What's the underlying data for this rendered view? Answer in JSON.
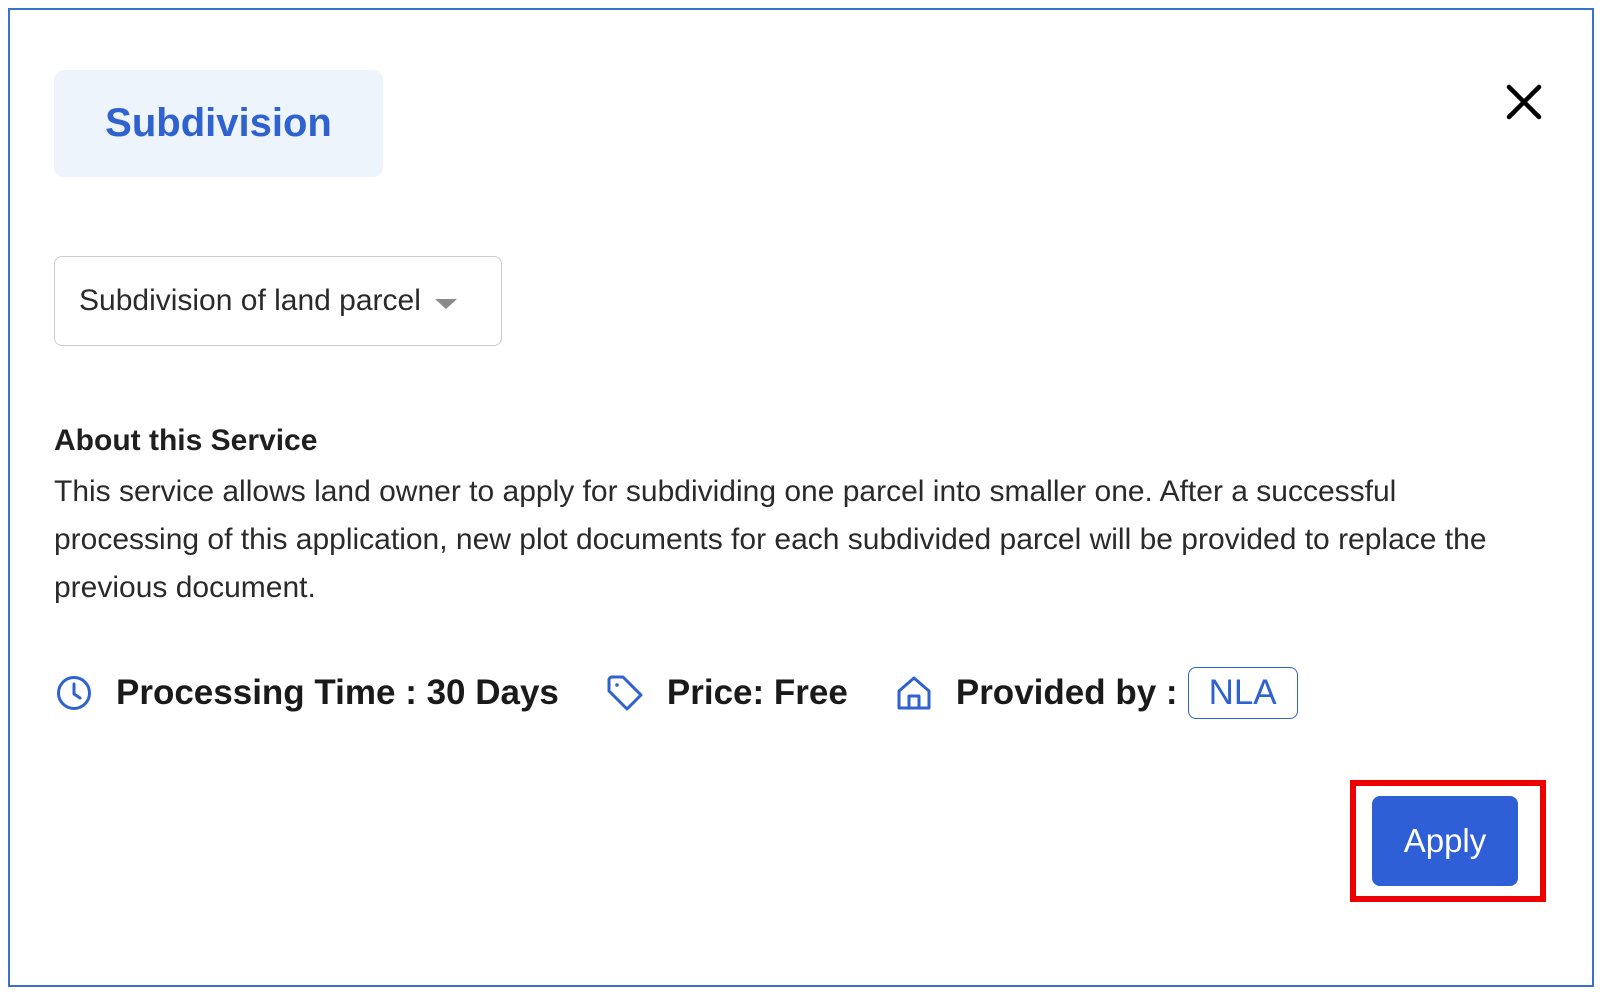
{
  "dialog": {
    "service_chip_label": "Subdivision",
    "close_icon": "close-icon",
    "dropdown": {
      "selected_value": "Subdivision of land parcel",
      "icon": "chevron-down-icon"
    },
    "about": {
      "heading": "About this Service",
      "text": "This service allows land owner to apply for subdividing one parcel into smaller one. After a successful processing of this application, new plot documents for each subdivided parcel will be provided to replace the previous document."
    },
    "meta": {
      "processing_label": "Processing Time : 30 Days",
      "processing_icon": "clock-icon",
      "price_label": "Price: Free",
      "price_icon": "tag-icon",
      "provided_by_label": "Provided by :",
      "provided_by_icon": "home-icon",
      "provider_name": "NLA"
    },
    "apply_button_label": "Apply"
  },
  "colors": {
    "accent": "#2f62cf",
    "apply_button": "#2e5fd6",
    "chip_background": "#eef4fc",
    "frame_border": "#3b6fd0",
    "highlight": "#ee0000"
  }
}
